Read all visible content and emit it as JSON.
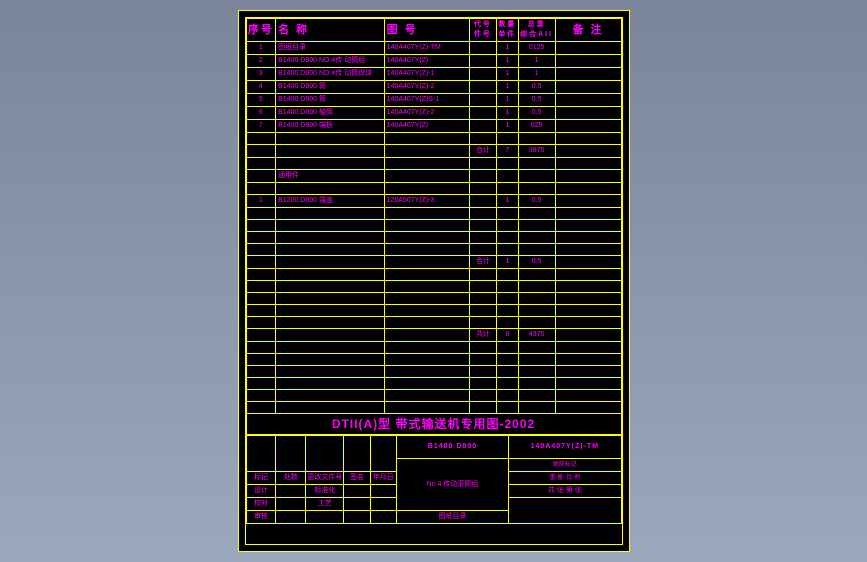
{
  "header": {
    "seq": "序号",
    "name": "名 称",
    "drwno": "图 号",
    "code_top": "代号",
    "code_bot": "件号",
    "qty_top": "数量",
    "qty_bot": "单件",
    "wt_top": "总重",
    "wt_bot": "综合AII",
    "note": "备 注"
  },
  "rows": [
    {
      "seq": "1",
      "name": "图纸目录",
      "drw": "140A407Y(Z)-TM",
      "code": "",
      "qty": "1",
      "wt1": "0125",
      "wt2": "",
      "note": ""
    },
    {
      "seq": "2",
      "name": "B1400 D800 NO 4传 动筒组",
      "drw": "140A407Y(Z)",
      "code": "",
      "qty": "1",
      "wt1": "1",
      "wt2": "",
      "note": ""
    },
    {
      "seq": "3",
      "name": "B1400 D800 NO 4传 动筒焊体",
      "drw": "140A407Y(Z)-1",
      "code": "",
      "qty": "1",
      "wt1": "1",
      "wt2": "",
      "note": ""
    },
    {
      "seq": "4",
      "name": "B1400 D800 筒",
      "drw": "140A407Y(Z)-2",
      "code": "",
      "qty": "1",
      "wt1": "0.5",
      "wt2": "",
      "note": ""
    },
    {
      "seq": "5",
      "name": "B1400 D800 筒",
      "drw": "140A407Y(Z)S-1",
      "code": "",
      "qty": "1",
      "wt1": "0.5",
      "wt2": "",
      "note": ""
    },
    {
      "seq": "6",
      "name": "B1400 D800 轴筒",
      "drw": "140A407Y(Z)-2",
      "code": "",
      "qty": "1",
      "wt1": "0.5",
      "wt2": "",
      "note": ""
    },
    {
      "seq": "7",
      "name": "B1400 D800 端板",
      "drw": "140A407Y(Z)",
      "code": "",
      "qty": "1",
      "wt1": "025",
      "wt2": "",
      "note": ""
    }
  ],
  "subtotal1": {
    "label": "合计",
    "qty": "7",
    "wt": "3875"
  },
  "attach_label": "通用件",
  "rows2": [
    {
      "seq": "1",
      "name": "B1200 D800 端盖",
      "drw": "120A507Y(Z)-3",
      "code": "",
      "qty": "1",
      "wt1": "0.5",
      "wt2": "",
      "note": ""
    }
  ],
  "subtotal2": {
    "label": "合计",
    "qty": "1",
    "wt": "0.5"
  },
  "grandtotal": {
    "label": "共计",
    "qty": "8",
    "wt": "4375"
  },
  "title_band": "DTII(A)型 带式输送机专用图-2002",
  "model": "B1400 D800",
  "sheet_no": "140A407Y(Z)-TM",
  "tb": {
    "r1": [
      "标记",
      "处数",
      "更改文件号",
      "签名",
      "年月日"
    ],
    "r2a": "设计",
    "r2b": "标准化",
    "r3a": "校对",
    "r3b": "工艺",
    "r4a": "审核",
    "r4b": "",
    "component": "No 4 传动滚筒组",
    "stage_h": "图样标记",
    "weight_h": "重 量",
    "scale_h": "比 例",
    "sheet": "共  张    第  张",
    "bottom": "图纸目录"
  }
}
